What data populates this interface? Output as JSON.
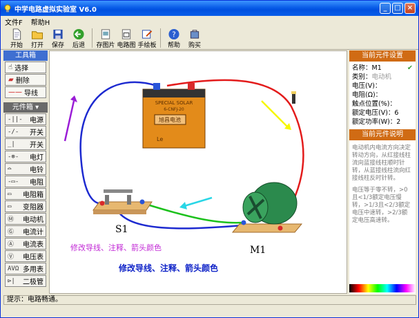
{
  "title": "中学电路虚拟实验室 V6.0",
  "menu": [
    "文件F",
    "帮助H"
  ],
  "toolbar": [
    {
      "label": "开始",
      "icon": "new-file-icon"
    },
    {
      "label": "打开",
      "icon": "open-folder-icon"
    },
    {
      "label": "保存",
      "icon": "save-disk-icon"
    },
    {
      "label": "后退",
      "icon": "back-arrow-icon"
    },
    {
      "label": "存图片",
      "icon": "save-image-icon"
    },
    {
      "label": "电路图",
      "icon": "circuit-diagram-icon"
    },
    {
      "label": "手绘板",
      "icon": "sketch-pad-icon"
    },
    {
      "label": "帮助",
      "icon": "help-icon"
    },
    {
      "label": "购买",
      "icon": "buy-icon"
    }
  ],
  "tools": {
    "header": "工具箱",
    "items": [
      {
        "label": "选择",
        "icon": "hand-icon"
      },
      {
        "label": "删除",
        "icon": "eraser-icon"
      },
      {
        "label": "导线",
        "icon": "wire-icon"
      }
    ]
  },
  "components": {
    "header": "元件箱",
    "items": [
      {
        "label": "电源",
        "icon": "battery-symbol-icon",
        "glyph": "-||-"
      },
      {
        "label": "开关",
        "icon": "switch-symbol-icon",
        "glyph": "-/-"
      },
      {
        "label": "开关",
        "icon": "switch2-symbol-icon",
        "glyph": "_|"
      },
      {
        "label": "电灯",
        "icon": "lamp-symbol-icon",
        "glyph": "-⊗-"
      },
      {
        "label": "电铃",
        "icon": "bell-symbol-icon",
        "glyph": "⌓"
      },
      {
        "label": "电阻",
        "icon": "resistor-symbol-icon",
        "glyph": "-▭-"
      },
      {
        "label": "电阻箱",
        "icon": "resistor-box-icon",
        "glyph": "▭"
      },
      {
        "label": "变阻器",
        "icon": "rheostat-icon",
        "glyph": "▭"
      },
      {
        "label": "电动机",
        "icon": "motor-symbol-icon",
        "glyph": "Ⓜ"
      },
      {
        "label": "电流计",
        "icon": "galvanometer-icon",
        "glyph": "Ⓖ"
      },
      {
        "label": "电流表",
        "icon": "ammeter-icon",
        "glyph": "Ⓐ"
      },
      {
        "label": "电压表",
        "icon": "voltmeter-icon",
        "glyph": "Ⓥ"
      },
      {
        "label": "多用表",
        "icon": "multimeter-icon",
        "glyph": "AVΩ"
      },
      {
        "label": "二极管",
        "icon": "diode-icon",
        "glyph": "⊳|"
      }
    ]
  },
  "canvas": {
    "battery_text": "SPECIAL SOLAR",
    "battery_sub": "6-CNFJ-20",
    "battery_label": "旭昌电池",
    "battery_badge": "Le",
    "switch_label": "S1",
    "motor_label": "M1",
    "note1": "修改导线、注释、箭头颜色",
    "note2": "修改导线、注释、箭头颜色"
  },
  "properties": {
    "header": "当前元件设置",
    "name_label": "名称：",
    "name_value": "M1",
    "category_label": "类别：",
    "category_value": "电动机",
    "voltage": "电压(V)：",
    "resistance": "电阻(Ω)：",
    "contact": "触点位置(%)：",
    "rated_v": "额定电压(V)：6",
    "rated_p": "额定功率(W)：2"
  },
  "description": {
    "header": "当前元件说明",
    "p1": "电动机内电流方向决定转动方向，从红接线柱流向蓝接线柱顺时针转，从蓝接线柱流向红接线柱反时针转。",
    "p2": "电压等于零不转，>0且<1/3额定电压慢转，>1/3且<2/3额定电压中速转，>2/3额定电压高速转。"
  },
  "status": "提示：电路畅通。",
  "colors": {
    "accent": "#d06b14",
    "title": "#0a5de8"
  }
}
